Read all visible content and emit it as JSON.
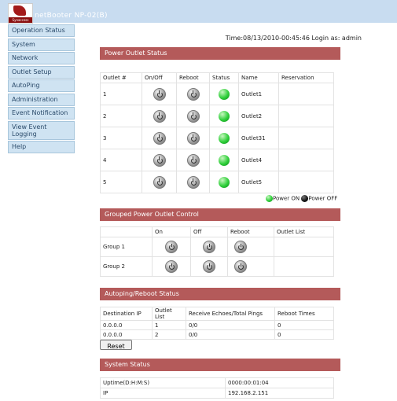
{
  "header": {
    "logo_text": "Synaccess",
    "app_title": "netBooter NP-02(B)"
  },
  "sidebar": {
    "items": [
      {
        "label": "Operation Status"
      },
      {
        "label": "System"
      },
      {
        "label": "Network"
      },
      {
        "label": "Outlet Setup"
      },
      {
        "label": "AutoPing"
      },
      {
        "label": "Administration"
      },
      {
        "label": "Event Notification"
      },
      {
        "label": "View Event Logging"
      },
      {
        "label": "Help"
      }
    ]
  },
  "status_line": "Time:08/13/2010-00:45:46 Login as: admin",
  "power_outlet": {
    "title": "Power Outlet Status",
    "columns": [
      "Outlet #",
      "On/Off",
      "Reboot",
      "Status",
      "Name",
      "Reservation"
    ],
    "rows": [
      {
        "num": "1",
        "name": "Outlet1"
      },
      {
        "num": "2",
        "name": "Outlet2"
      },
      {
        "num": "3",
        "name": "Outlet31"
      },
      {
        "num": "4",
        "name": "Outlet4"
      },
      {
        "num": "5",
        "name": "Outlet5"
      }
    ],
    "legend_on": "Power ON",
    "legend_off": "Power OFF"
  },
  "group_control": {
    "title": "Grouped Power Outlet Control",
    "columns": [
      "",
      "On",
      "Off",
      "Reboot",
      "Outlet List"
    ],
    "rows": [
      {
        "name": "Group 1"
      },
      {
        "name": "Group 2"
      }
    ]
  },
  "autoping": {
    "title": "Autoping/Reboot Status",
    "columns": [
      "Destination IP",
      "Outlet List",
      "Receive Echoes/Total Pings",
      "Reboot Times"
    ],
    "rows": [
      {
        "ip": "0.0.0.0",
        "outlet": "1",
        "echoes": "0/0",
        "reboots": "0"
      },
      {
        "ip": "0.0.0.0",
        "outlet": "2",
        "echoes": "0/0",
        "reboots": "0"
      }
    ],
    "reset_label": "Reset"
  },
  "system_status": {
    "title": "System Status",
    "rows": [
      {
        "label": "Uptime(D:H:M:S)",
        "value": "0000:00:01:04"
      },
      {
        "label": "IP",
        "value": "192.168.2.151"
      }
    ]
  }
}
